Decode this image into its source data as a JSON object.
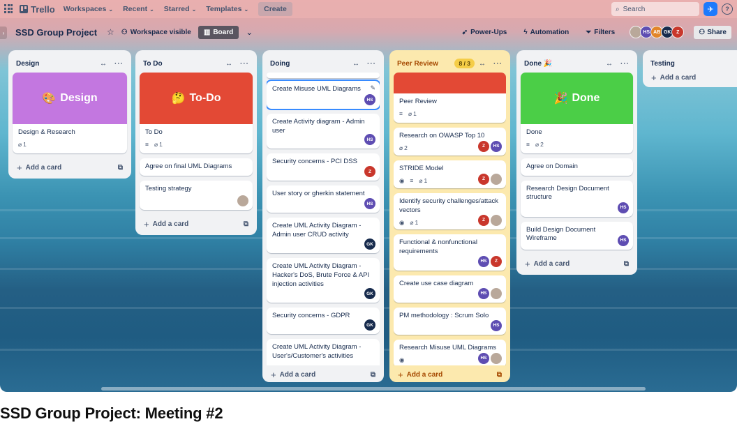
{
  "topbar": {
    "app_name": "Trello",
    "menus": [
      "Workspaces",
      "Recent",
      "Starred",
      "Templates"
    ],
    "create_label": "Create",
    "search_placeholder": "Search"
  },
  "board": {
    "title": "SSD Group Project",
    "visibility_label": "Workspace visible",
    "view_label": "Board",
    "power_ups_label": "Power-Ups",
    "automation_label": "Automation",
    "filters_label": "Filters",
    "members": [
      "HS",
      "AB",
      "GK",
      "Z"
    ],
    "share_label": "Share"
  },
  "lists": {
    "design": {
      "title": "Design",
      "cover_label": "Design",
      "cover_emoji": "🎨",
      "card1_title": "Design & Research",
      "card1_attachments": "1",
      "add_label": "Add a card"
    },
    "todo": {
      "title": "To Do",
      "cover_label": "To-Do",
      "cover_emoji": "🤔",
      "card1_title": "To Do",
      "card1_attachments": "1",
      "card2_title": "Agree on final UML Diagrams",
      "card3_title": "Testing strategy",
      "add_label": "Add a card"
    },
    "doing": {
      "title": "Doing",
      "cards": [
        {
          "title": "Create Misuse UML Diagrams",
          "member": "HS"
        },
        {
          "title": "Create Activity diagram - Admin user",
          "member": "HS"
        },
        {
          "title": "Security concerns - PCI DSS",
          "member": "Z"
        },
        {
          "title": "User story or gherkin statement",
          "member": "HS"
        },
        {
          "title": "Create UML Activity Diagram - Admin user CRUD activity",
          "member": "GK"
        },
        {
          "title": "Create UML Activity Diagram - Hacker's DoS, Brute Force & API injection activities",
          "member": "GK"
        },
        {
          "title": "Security concerns - GDPR",
          "member": "GK"
        },
        {
          "title": "Create UML Activity Diagram - User's/Customer's activities",
          "member": ""
        }
      ],
      "add_label": "Add a card"
    },
    "peer_review": {
      "title": "Peer Review",
      "badge": "8 / 3",
      "card1_title": "Peer Review",
      "card1_attachments": "1",
      "card2_title": "Research on OWASP Top 10",
      "card2_attachments": "2",
      "card3_title": "STRIDE Model",
      "card3_attachments": "1",
      "card4_title": "Identify security challenges/attack vectors",
      "card4_attachments": "1",
      "card5_title": "Functional & nonfunctional requirements",
      "card6_title": "Create use case diagram",
      "card7_title": "PM methodology : Scrum Solo",
      "card8_title": "Research Misuse UML Diagrams",
      "add_label": "Add a card"
    },
    "done": {
      "title": "Done",
      "title_emoji": "🎉",
      "cover_label": "Done",
      "cover_emoji": "🎉",
      "card1_title": "Done",
      "card1_attachments": "2",
      "card2_title": "Agree on Domain",
      "card3_title": "Research Design Document structure",
      "card3_member": "HS",
      "card4_title": "Build Design Document Wireframe",
      "card4_member": "HS",
      "add_label": "Add a card"
    },
    "testing": {
      "title": "Testing",
      "add_label": "Add a card"
    }
  },
  "video_title": "SSD Group Project: Meeting #2",
  "colors": {
    "design_cover": "#c377e0",
    "todo_cover": "#e34935",
    "peer_cover": "#e34935",
    "done_cover": "#4bce47",
    "hs": "#5e4db2",
    "ab": "#e2852a",
    "gk": "#172b4d",
    "z": "#c9372c"
  }
}
